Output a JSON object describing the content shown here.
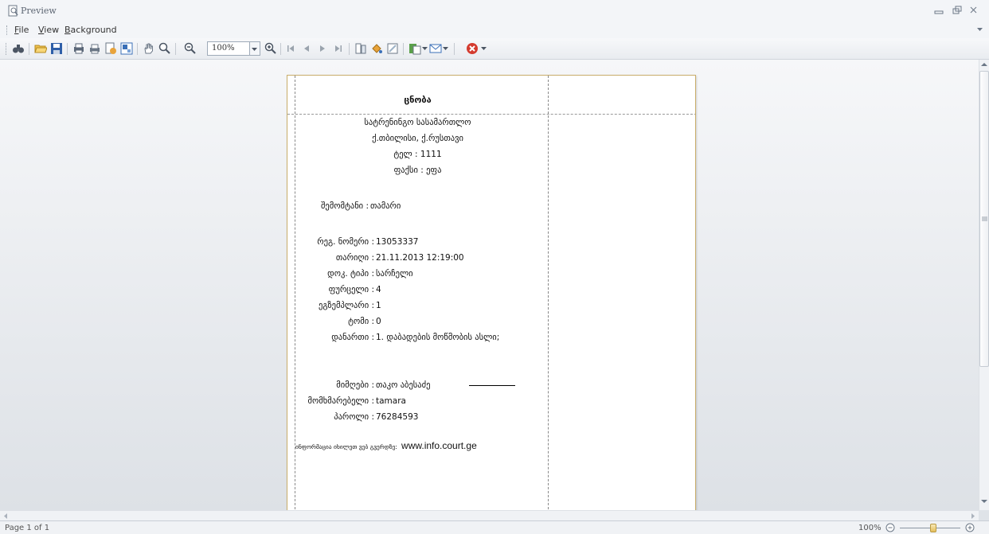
{
  "window": {
    "title": "Preview"
  },
  "menu": {
    "file_prefix": "",
    "file_ul": "F",
    "file_rest": "ile",
    "view_ul": "V",
    "view_rest": "iew",
    "bg_ul": "B",
    "bg_rest": "ackground"
  },
  "toolbar": {
    "zoom_value": "100%"
  },
  "document": {
    "heading": "ცნობა",
    "header_lines": [
      "სატრენინგო სასამართლო",
      "ქ.თბილისი, ქ.რუსთავი",
      "ტელ : 1111",
      "ფაქსი : ეფა"
    ],
    "submitter_label": "შემომტანი :",
    "submitter_value": "თამარი",
    "fields": [
      {
        "label": "რეგ. ნომერი :",
        "value": "13053337"
      },
      {
        "label": "თარიღი :",
        "value": "21.11.2013 12:19:00"
      },
      {
        "label": "დოკ. ტიპი :",
        "value": "სარჩელი"
      },
      {
        "label": "ფურცელი :",
        "value": "4"
      },
      {
        "label": "ეგზემპლარი :",
        "value": "1"
      },
      {
        "label": "ტომი :",
        "value": "0"
      },
      {
        "label": "დანართი :",
        "value": "1. დაბადების მოწმობის ასლი;"
      }
    ],
    "receiver_label": "მიმღები :",
    "receiver_value": "თაკო აბესაძე",
    "user_label": "მომხმარებელი :",
    "user_value": "tamara",
    "password_label": "პაროლი :",
    "password_value": "76284593",
    "info_prefix": "ინფორმაცია იხილეთ ვებ გვერდზე:",
    "info_url": "www.info.court.ge"
  },
  "status": {
    "page_text": "Page 1 of 1",
    "zoom_text": "100%"
  },
  "colors": {
    "page_border": "#c9ad6a",
    "workspace_top": "#f6f7f9",
    "workspace_bottom": "#dde1e6",
    "close_icon": "#d43b2f"
  }
}
